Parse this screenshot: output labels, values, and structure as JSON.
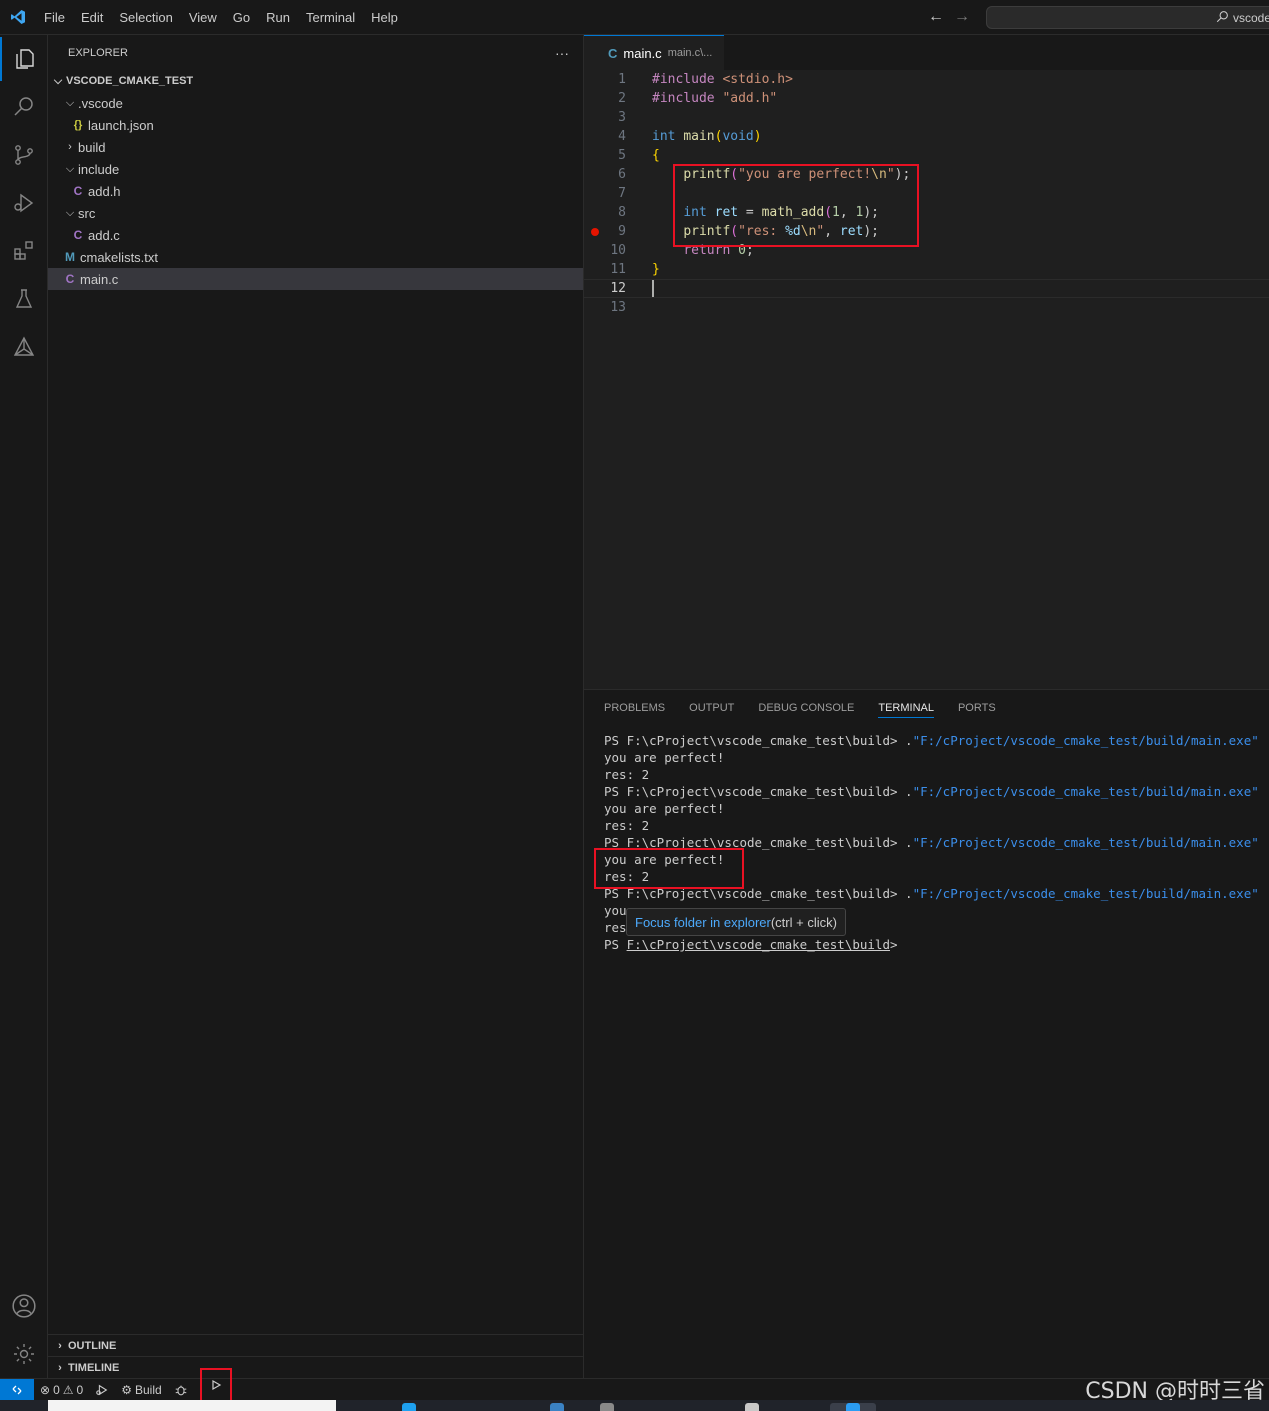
{
  "menu": [
    "File",
    "Edit",
    "Selection",
    "View",
    "Go",
    "Run",
    "Terminal",
    "Help"
  ],
  "command_center": {
    "text": "vscode"
  },
  "sidebar": {
    "title": "EXPLORER",
    "more": "···",
    "workspace": "VSCODE_CMAKE_TEST",
    "tree": [
      {
        "label": ".vscode",
        "type": "folder-open"
      },
      {
        "label": "launch.json",
        "type": "json",
        "icon": "{}"
      },
      {
        "label": "build",
        "type": "folder-closed"
      },
      {
        "label": "include",
        "type": "folder-open"
      },
      {
        "label": "add.h",
        "type": "c",
        "icon": "C"
      },
      {
        "label": "src",
        "type": "folder-open"
      },
      {
        "label": "add.c",
        "type": "c",
        "icon": "C"
      },
      {
        "label": "cmakelists.txt",
        "type": "cmake",
        "icon": "M"
      },
      {
        "label": "main.c",
        "type": "c",
        "icon": "C",
        "selected": true
      }
    ],
    "outline": "OUTLINE",
    "timeline": "TIMELINE"
  },
  "editor": {
    "tab": {
      "icon": "C",
      "name": "main.c",
      "desc": "main.c\\..."
    },
    "line_numbers": [
      "1",
      "2",
      "3",
      "4",
      "5",
      "6",
      "7",
      "8",
      "9",
      "10",
      "11",
      "12",
      "13"
    ],
    "lines": {
      "l1": {
        "a": "#include",
        "b": " <stdio.h>"
      },
      "l2": {
        "a": "#include",
        "b": " \"add.h\""
      },
      "l4": {
        "a": "int",
        "b": " ",
        "c": "main",
        "d": "(",
        "e": "void",
        "f": ")"
      },
      "l5": {
        "a": "{"
      },
      "l6": {
        "a": "    ",
        "b": "printf",
        "c": "(",
        "d": "\"you are perfect!",
        "e": "\\n",
        "f": "\"",
        "g": ");"
      },
      "l8": {
        "a": "    ",
        "b": "int",
        "c": " ",
        "d": "ret",
        "e": " = ",
        "f": "math_add",
        "g": "(",
        "h": "1",
        "i": ", ",
        "j": "1",
        "k": ");"
      },
      "l9": {
        "a": "    ",
        "b": "printf",
        "c": "(",
        "d": "\"res: ",
        "e": "%d",
        "f": "\\n",
        "g": "\"",
        "h": ", ",
        "i": "ret",
        "j": ");"
      },
      "l10": {
        "a": "    ",
        "b": "return",
        "c": " ",
        "d": "0",
        "e": ";"
      },
      "l11": {
        "a": "}"
      }
    },
    "current_line": "12",
    "breakpoint_line": "9"
  },
  "panel": {
    "tabs": [
      "PROBLEMS",
      "OUTPUT",
      "DEBUG CONSOLE",
      "TERMINAL",
      "PORTS"
    ],
    "active_tab": "TERMINAL",
    "terminal": {
      "prompt": "PS F:\\cProject\\vscode_cmake_test\\build> ",
      "dot": ".",
      "cmd": "\"F:/cProject/vscode_cmake_test/build/main.exe\"",
      "out1": "you are perfect!",
      "out2": "res: 2",
      "partial1": "you",
      "partial2": "res",
      "last_ps": "PS ",
      "last_path": "F:\\cProject\\vscode_cmake_test\\build",
      "last_gt": ">"
    },
    "tooltip": {
      "link": "Focus folder in explorer",
      "hint": " (ctrl + click)"
    }
  },
  "statusbar": {
    "errors": "0",
    "warnings": "0",
    "build": "Build"
  },
  "watermark": "CSDN @时时三省",
  "colors": {
    "accent": "#0078d4",
    "highlight_box": "#e81123",
    "breakpoint": "#e51400"
  }
}
